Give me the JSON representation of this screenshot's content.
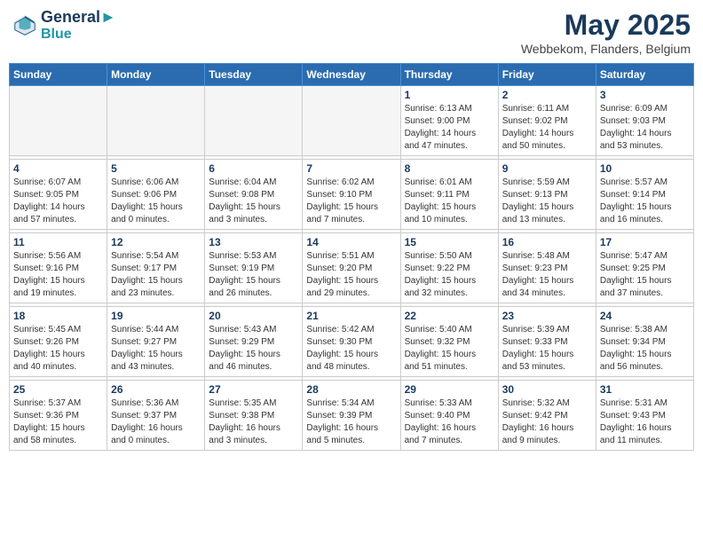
{
  "header": {
    "logo_line1": "General",
    "logo_line2": "Blue",
    "title": "May 2025",
    "subtitle": "Webbekom, Flanders, Belgium"
  },
  "weekdays": [
    "Sunday",
    "Monday",
    "Tuesday",
    "Wednesday",
    "Thursday",
    "Friday",
    "Saturday"
  ],
  "weeks": [
    [
      {
        "day": "",
        "info": ""
      },
      {
        "day": "",
        "info": ""
      },
      {
        "day": "",
        "info": ""
      },
      {
        "day": "",
        "info": ""
      },
      {
        "day": "1",
        "info": "Sunrise: 6:13 AM\nSunset: 9:00 PM\nDaylight: 14 hours\nand 47 minutes."
      },
      {
        "day": "2",
        "info": "Sunrise: 6:11 AM\nSunset: 9:02 PM\nDaylight: 14 hours\nand 50 minutes."
      },
      {
        "day": "3",
        "info": "Sunrise: 6:09 AM\nSunset: 9:03 PM\nDaylight: 14 hours\nand 53 minutes."
      }
    ],
    [
      {
        "day": "4",
        "info": "Sunrise: 6:07 AM\nSunset: 9:05 PM\nDaylight: 14 hours\nand 57 minutes."
      },
      {
        "day": "5",
        "info": "Sunrise: 6:06 AM\nSunset: 9:06 PM\nDaylight: 15 hours\nand 0 minutes."
      },
      {
        "day": "6",
        "info": "Sunrise: 6:04 AM\nSunset: 9:08 PM\nDaylight: 15 hours\nand 3 minutes."
      },
      {
        "day": "7",
        "info": "Sunrise: 6:02 AM\nSunset: 9:10 PM\nDaylight: 15 hours\nand 7 minutes."
      },
      {
        "day": "8",
        "info": "Sunrise: 6:01 AM\nSunset: 9:11 PM\nDaylight: 15 hours\nand 10 minutes."
      },
      {
        "day": "9",
        "info": "Sunrise: 5:59 AM\nSunset: 9:13 PM\nDaylight: 15 hours\nand 13 minutes."
      },
      {
        "day": "10",
        "info": "Sunrise: 5:57 AM\nSunset: 9:14 PM\nDaylight: 15 hours\nand 16 minutes."
      }
    ],
    [
      {
        "day": "11",
        "info": "Sunrise: 5:56 AM\nSunset: 9:16 PM\nDaylight: 15 hours\nand 19 minutes."
      },
      {
        "day": "12",
        "info": "Sunrise: 5:54 AM\nSunset: 9:17 PM\nDaylight: 15 hours\nand 23 minutes."
      },
      {
        "day": "13",
        "info": "Sunrise: 5:53 AM\nSunset: 9:19 PM\nDaylight: 15 hours\nand 26 minutes."
      },
      {
        "day": "14",
        "info": "Sunrise: 5:51 AM\nSunset: 9:20 PM\nDaylight: 15 hours\nand 29 minutes."
      },
      {
        "day": "15",
        "info": "Sunrise: 5:50 AM\nSunset: 9:22 PM\nDaylight: 15 hours\nand 32 minutes."
      },
      {
        "day": "16",
        "info": "Sunrise: 5:48 AM\nSunset: 9:23 PM\nDaylight: 15 hours\nand 34 minutes."
      },
      {
        "day": "17",
        "info": "Sunrise: 5:47 AM\nSunset: 9:25 PM\nDaylight: 15 hours\nand 37 minutes."
      }
    ],
    [
      {
        "day": "18",
        "info": "Sunrise: 5:45 AM\nSunset: 9:26 PM\nDaylight: 15 hours\nand 40 minutes."
      },
      {
        "day": "19",
        "info": "Sunrise: 5:44 AM\nSunset: 9:27 PM\nDaylight: 15 hours\nand 43 minutes."
      },
      {
        "day": "20",
        "info": "Sunrise: 5:43 AM\nSunset: 9:29 PM\nDaylight: 15 hours\nand 46 minutes."
      },
      {
        "day": "21",
        "info": "Sunrise: 5:42 AM\nSunset: 9:30 PM\nDaylight: 15 hours\nand 48 minutes."
      },
      {
        "day": "22",
        "info": "Sunrise: 5:40 AM\nSunset: 9:32 PM\nDaylight: 15 hours\nand 51 minutes."
      },
      {
        "day": "23",
        "info": "Sunrise: 5:39 AM\nSunset: 9:33 PM\nDaylight: 15 hours\nand 53 minutes."
      },
      {
        "day": "24",
        "info": "Sunrise: 5:38 AM\nSunset: 9:34 PM\nDaylight: 15 hours\nand 56 minutes."
      }
    ],
    [
      {
        "day": "25",
        "info": "Sunrise: 5:37 AM\nSunset: 9:36 PM\nDaylight: 15 hours\nand 58 minutes."
      },
      {
        "day": "26",
        "info": "Sunrise: 5:36 AM\nSunset: 9:37 PM\nDaylight: 16 hours\nand 0 minutes."
      },
      {
        "day": "27",
        "info": "Sunrise: 5:35 AM\nSunset: 9:38 PM\nDaylight: 16 hours\nand 3 minutes."
      },
      {
        "day": "28",
        "info": "Sunrise: 5:34 AM\nSunset: 9:39 PM\nDaylight: 16 hours\nand 5 minutes."
      },
      {
        "day": "29",
        "info": "Sunrise: 5:33 AM\nSunset: 9:40 PM\nDaylight: 16 hours\nand 7 minutes."
      },
      {
        "day": "30",
        "info": "Sunrise: 5:32 AM\nSunset: 9:42 PM\nDaylight: 16 hours\nand 9 minutes."
      },
      {
        "day": "31",
        "info": "Sunrise: 5:31 AM\nSunset: 9:43 PM\nDaylight: 16 hours\nand 11 minutes."
      }
    ]
  ]
}
